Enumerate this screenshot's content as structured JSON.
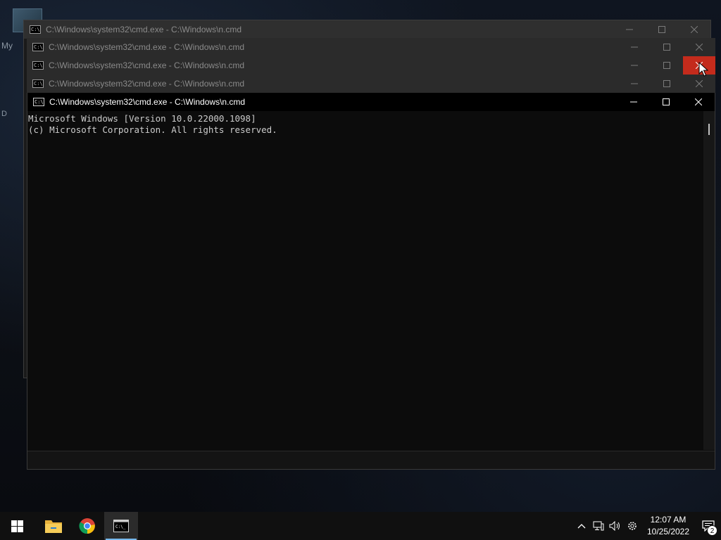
{
  "desktop": {
    "labels": [
      "My",
      "D"
    ]
  },
  "windows": [
    {
      "title": "C:\\Windows\\system32\\cmd.exe - C:\\Windows\\n.cmd",
      "icon_text": "C:\\"
    },
    {
      "title": "C:\\Windows\\system32\\cmd.exe - C:\\Windows\\n.cmd",
      "icon_text": "C:\\"
    },
    {
      "title": "C:\\Windows\\system32\\cmd.exe - C:\\Windows\\n.cmd",
      "icon_text": "C:\\"
    },
    {
      "title": "C:\\Windows\\system32\\cmd.exe - C:\\Windows\\n.cmd",
      "icon_text": "C:\\"
    },
    {
      "title": "C:\\Windows\\system32\\cmd.exe - C:\\Windows\\n.cmd",
      "icon_text": "C:\\"
    }
  ],
  "console": {
    "line1": "Microsoft Windows [Version 10.0.22000.1098]",
    "line2": "(c) Microsoft Corporation. All rights reserved."
  },
  "taskbar": {
    "apps": [
      {
        "name": "start",
        "icon": "windows-logo-icon"
      },
      {
        "name": "file-explorer",
        "icon": "folder-icon"
      },
      {
        "name": "chrome",
        "icon": "chrome-icon"
      },
      {
        "name": "command-prompt",
        "icon": "cmd-icon",
        "active": true
      }
    ],
    "tray": {
      "time": "12:07 AM",
      "date": "10/25/2022",
      "notification_count": "2"
    }
  },
  "colors": {
    "close_hover": "#c42b1c",
    "taskbar_active_underline": "#76b9ed",
    "console_bg": "#0c0c0c",
    "console_text": "#cccccc"
  }
}
